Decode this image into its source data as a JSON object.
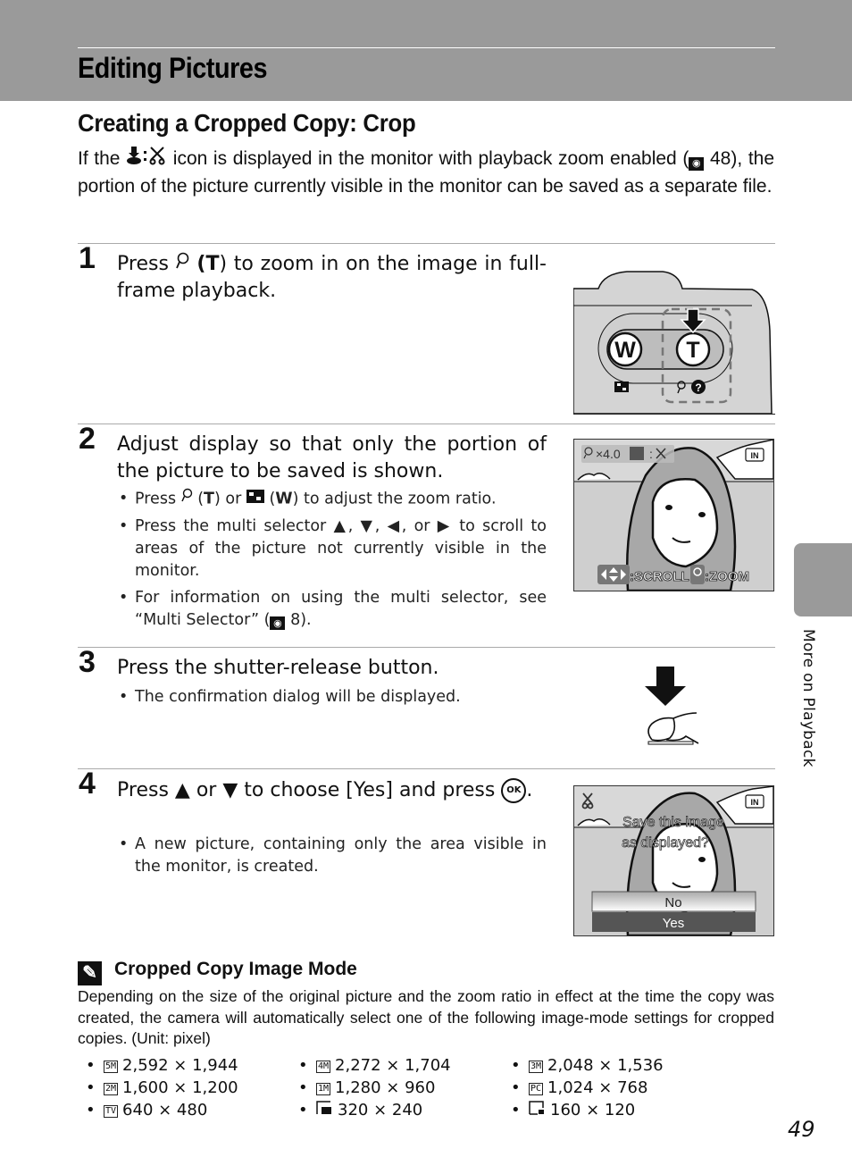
{
  "header": {
    "title": "Editing Pictures"
  },
  "section": {
    "title": "Creating a Cropped Copy: Crop",
    "intro_before_icon": "If the",
    "intro_icon": "print-crop-icon",
    "intro_after_icon": "icon is displayed in the monitor with playback zoom enabled (",
    "intro_ref_icon": "page-ref-icon",
    "intro_ref_page": "48",
    "intro_end": "), the portion of the picture currently visible in the monitor can be saved as a separate file."
  },
  "steps": [
    {
      "number": "1",
      "title_parts": [
        "Press",
        "(",
        "T",
        ") to zoom in on the image in full-frame playback."
      ],
      "figure": {
        "type": "camera-zoom-buttons",
        "w_label": "W",
        "t_label": "T"
      }
    },
    {
      "number": "2",
      "title": "Adjust display so that only the portion of the picture to be saved is shown.",
      "bullets": [
        {
          "parts": [
            "Press",
            "(",
            "T",
            ") or",
            "(",
            "W",
            ") to adjust the zoom ratio."
          ]
        },
        {
          "parts": [
            "Press the multi selector",
            "▲",
            ",",
            "▼",
            ",",
            "◀",
            ", or",
            "▶",
            "to scroll to areas of the picture not currently visible in the monitor."
          ]
        },
        {
          "parts": [
            "For information on using the multi selector, see “Multi Selector” (",
            "8",
            ")."
          ]
        }
      ],
      "figure": {
        "type": "playback-zoom-screen",
        "zoom_readout": "×4.0",
        "memory_badge": "IN",
        "scroll_label": ":SCROLL",
        "zoom_label": ":ZOOM"
      }
    },
    {
      "number": "3",
      "title": "Press the shutter-release button.",
      "bullets": [
        {
          "text": "The confirmation dialog will be displayed."
        }
      ],
      "figure": {
        "type": "shutter-press-illustration"
      }
    },
    {
      "number": "4",
      "title_parts": [
        "Press",
        "▲",
        "or",
        "▼",
        "to choose [Yes] and press",
        "OK",
        "."
      ],
      "bullets": [
        {
          "text": "A new picture, containing only the area visible in the monitor, is created."
        }
      ],
      "figure": {
        "type": "confirm-dialog-screen",
        "memory_badge": "IN",
        "prompt_line1": "Save this image",
        "prompt_line2": "as displayed?",
        "options": [
          "No",
          "Yes"
        ],
        "selected_option": "Yes"
      }
    }
  ],
  "note": {
    "title": "Cropped Copy Image Mode",
    "body": "Depending on the size of the original picture and the zoom ratio in effect at the time the copy was created, the camera will automatically select one of the following image-mode settings for cropped copies. (Unit: pixel)",
    "modes": [
      {
        "icon": "5M",
        "size": "2,592 × 1,944"
      },
      {
        "icon": "4M",
        "size": "2,272 × 1,704"
      },
      {
        "icon": "3M",
        "size": "2,048 × 1,536"
      },
      {
        "icon": "2M",
        "size": "1,600 × 1,200"
      },
      {
        "icon": "1M",
        "size": "1,280 × 960"
      },
      {
        "icon": "PC",
        "size": "1,024 × 768"
      },
      {
        "icon": "TV",
        "size": "640 × 480"
      },
      {
        "icon": "small-320",
        "size": "320 × 240"
      },
      {
        "icon": "small-160",
        "size": "160 × 120"
      }
    ]
  },
  "side_tab": {
    "label": "More on Playback"
  },
  "page_number": "49"
}
